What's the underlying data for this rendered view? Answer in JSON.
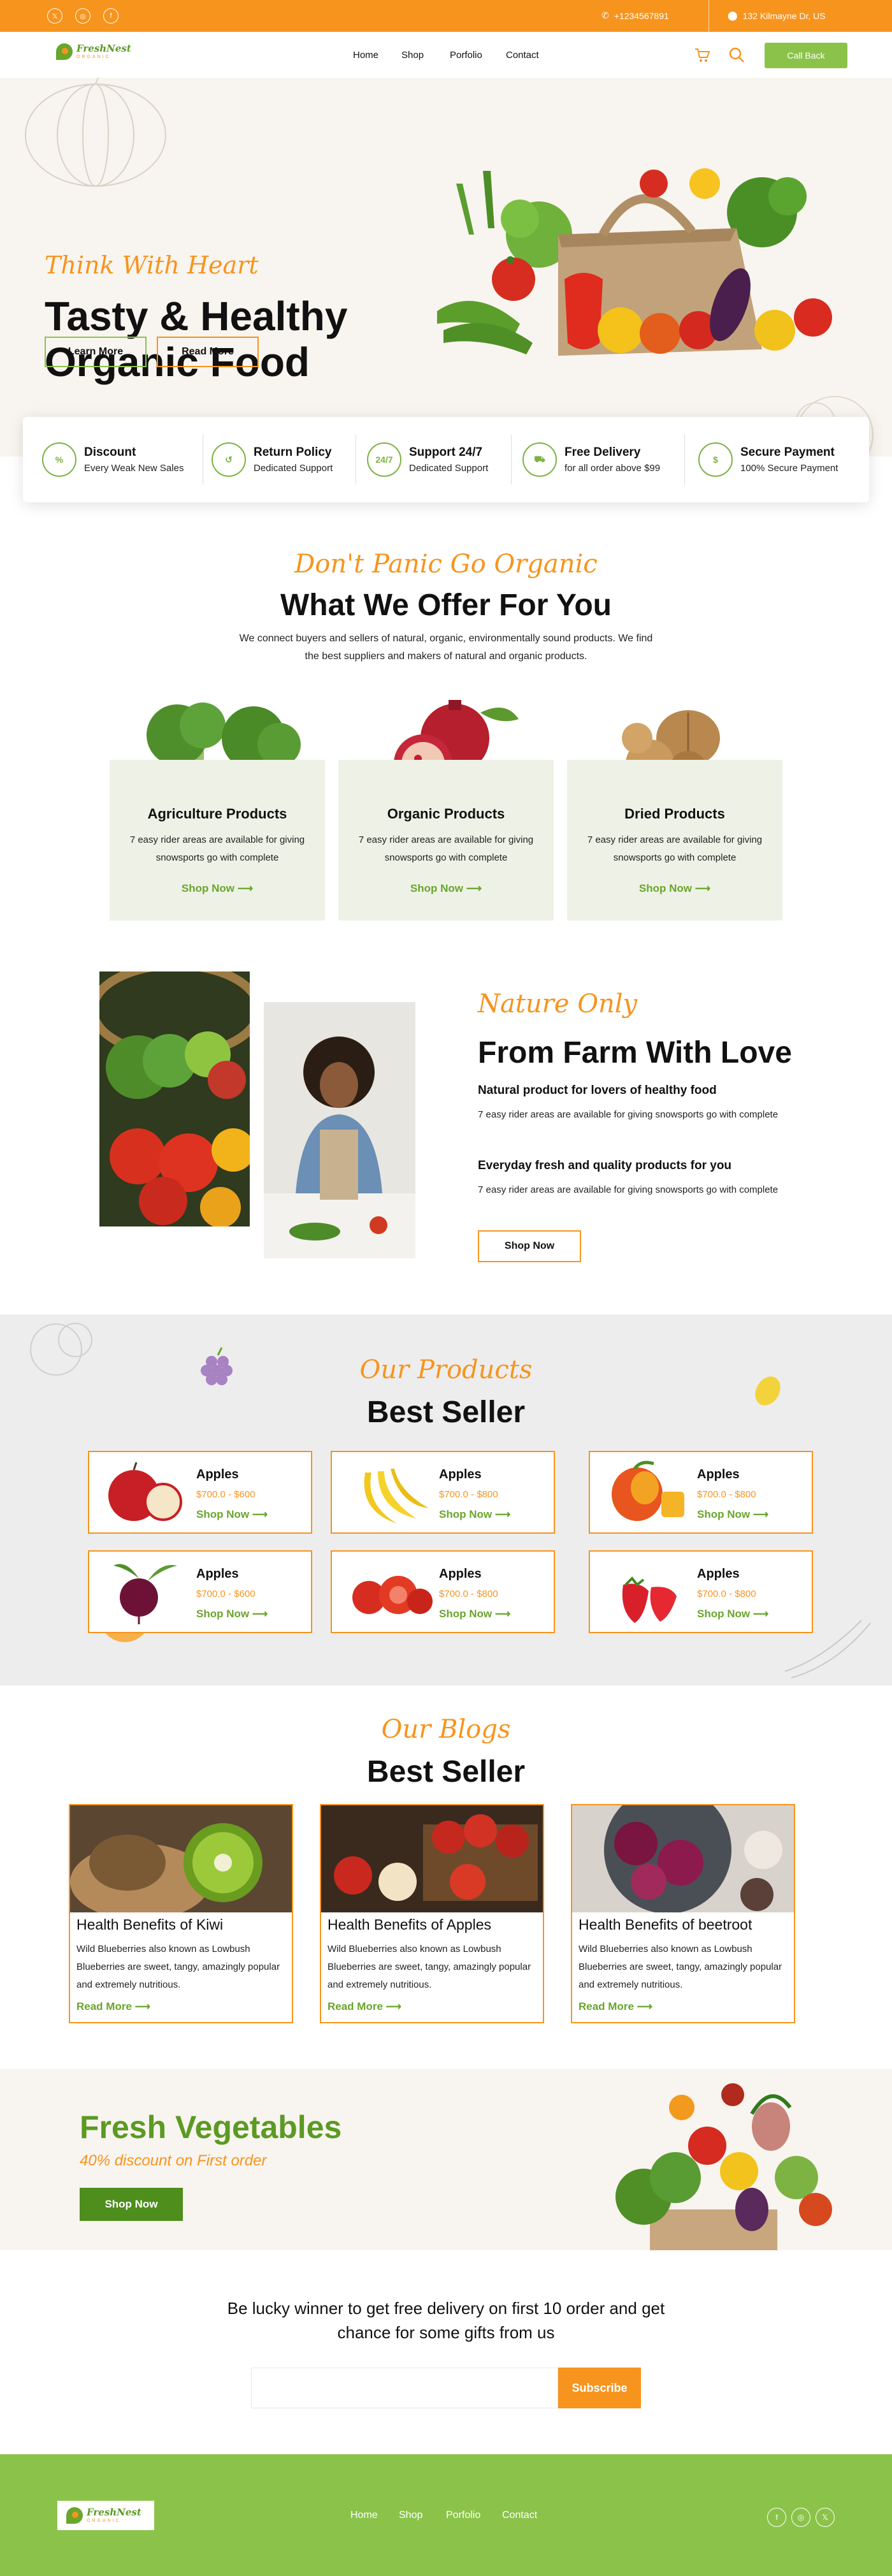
{
  "topbar": {
    "social": [
      {
        "name": "x-icon",
        "glyph": "𝕏"
      },
      {
        "name": "instagram-icon",
        "glyph": "◎"
      },
      {
        "name": "facebook-icon",
        "glyph": "f"
      }
    ],
    "phone": "+1234567891",
    "address": "132 Kilmayne Dr, US"
  },
  "logo": {
    "name": "FreshNest",
    "tagline": "ORGANIC"
  },
  "nav": {
    "items": [
      "Home",
      "Shop",
      "Porfolio",
      "Contact"
    ],
    "cart_icon": "cart-icon",
    "search_icon": "search-icon",
    "cta": "Call Back"
  },
  "hero": {
    "tagline": "Think With Heart",
    "title": "Tasty & Healthy Organic Food",
    "primary_btn": "Learn More",
    "secondary_btn": "Read More"
  },
  "features": [
    {
      "title": "Discount",
      "sub": "Every Weak New Sales",
      "icon": "discount-icon"
    },
    {
      "title": "Return Policy",
      "sub": "Dedicated Support",
      "icon": "return-box-icon"
    },
    {
      "title": "Support 24/7",
      "sub": "Dedicated Support",
      "icon": "support-24-7-icon"
    },
    {
      "title": "Free Delivery",
      "sub": "for all order above $99",
      "icon": "delivery-truck-icon"
    },
    {
      "title": "Secure Payment",
      "sub": "100% Secure Payment",
      "icon": "secure-payment-icon"
    }
  ],
  "offer": {
    "script": "Don't Panic Go Organic",
    "title": "What We Offer For You",
    "desc_line1": "We connect buyers and sellers of natural, organic, environmentally sound products. We find",
    "desc_line2": "the best suppliers and makers of natural and organic products.",
    "cards": [
      {
        "title": "Agriculture Products",
        "desc": "7 easy rider areas are available for giving snowsports go with complete",
        "link": "Shop Now"
      },
      {
        "title": "Organic Products",
        "desc": "7 easy rider areas are available for giving snowsports go with complete",
        "link": "Shop Now"
      },
      {
        "title": "Dried Products",
        "desc": "7 easy rider areas are available for giving snowsports go with complete",
        "link": "Shop Now"
      }
    ]
  },
  "farm": {
    "script": "Nature Only",
    "title": "From Farm With Love",
    "h1": "Natural product for lovers of healthy food",
    "p1": "7 easy rider areas are available for giving snowsports go with complete",
    "h2": "Everyday fresh and quality  products for you",
    "p2": "7 easy rider areas are available for giving snowsports go with complete",
    "btn": "Shop Now"
  },
  "products": {
    "script": "Our Products",
    "title": "Best Seller",
    "items": [
      {
        "name": "Apples",
        "price": "$700.0 - $600",
        "link": "Shop Now"
      },
      {
        "name": "Apples",
        "price": "$700.0 - $800",
        "link": "Shop Now"
      },
      {
        "name": "Apples",
        "price": "$700.0 - $800",
        "link": "Shop Now"
      },
      {
        "name": "Apples",
        "price": "$700.0 - $600",
        "link": "Shop Now"
      },
      {
        "name": "Apples",
        "price": "$700.0 - $800",
        "link": "Shop Now"
      },
      {
        "name": "Apples",
        "price": "$700.0 - $800",
        "link": "Shop Now"
      }
    ]
  },
  "blogs": {
    "script": "Our Blogs",
    "title": "Best Seller",
    "items": [
      {
        "title": "Health Benefits of  Kiwi",
        "desc": "Wild Blueberries also known as Lowbush Blueberries are sweet, tangy, amazingly popular and extremely nutritious.",
        "link": "Read More"
      },
      {
        "title": "Health Benefits of  Apples",
        "desc": "Wild Blueberries also known as Lowbush Blueberries are sweet, tangy, amazingly popular and extremely nutritious.",
        "link": "Read More"
      },
      {
        "title": "Health Benefits of  beetroot",
        "desc": "Wild Blueberries also known as Lowbush Blueberries are sweet, tangy, amazingly popular and extremely nutritious.",
        "link": "Read More"
      }
    ]
  },
  "promo": {
    "title": "Fresh Vegetables",
    "sub": "40% discount on First order",
    "btn": "Shop Now"
  },
  "subscribe": {
    "text": "Be lucky winner to get free delivery on first 10 order and get chance for some gifts from us",
    "placeholder": "",
    "btn": "Subscribe"
  },
  "footer": {
    "items": [
      "Home",
      "Shop",
      "Porfolio",
      "Contact"
    ],
    "social": [
      {
        "name": "facebook-icon",
        "glyph": "f"
      },
      {
        "name": "instagram-icon",
        "glyph": "◎"
      },
      {
        "name": "x-icon",
        "glyph": "𝕏"
      }
    ]
  },
  "colors": {
    "accent_orange": "#f7941d",
    "accent_green": "#8bc34a",
    "dark_green": "#4e8e1c",
    "cream": "#f8f4ef"
  }
}
